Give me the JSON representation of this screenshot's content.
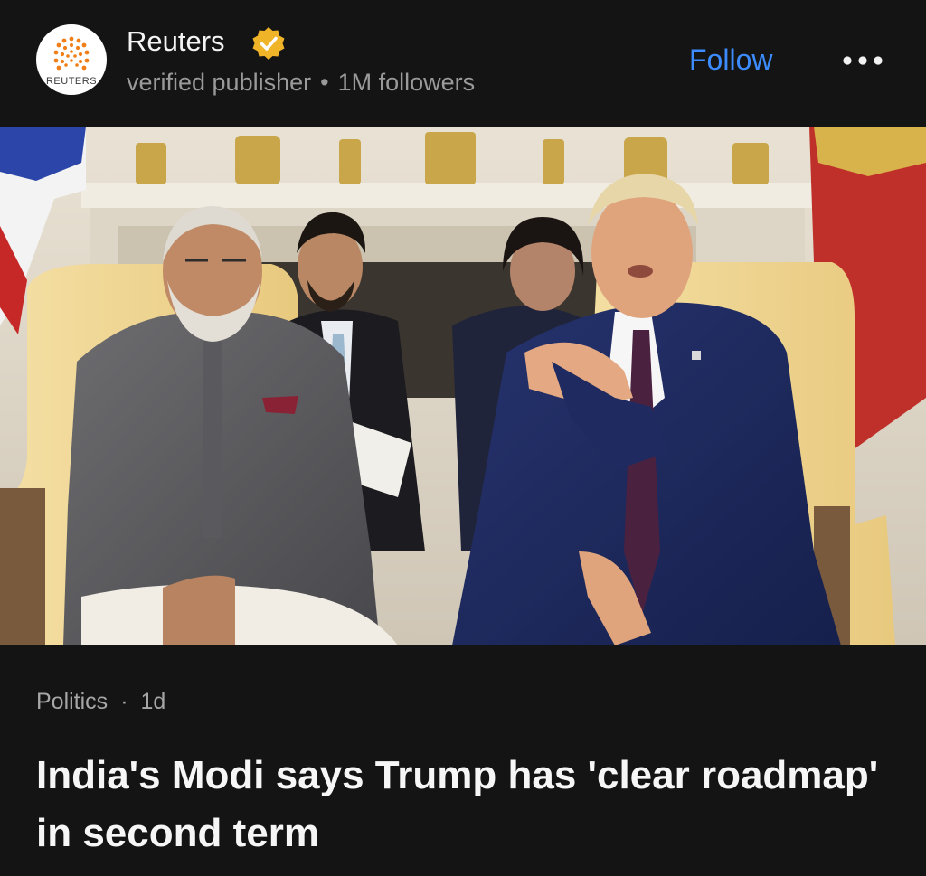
{
  "publisher": {
    "name": "Reuters",
    "logo_text": "REUTERS",
    "subtitle": "verified publisher",
    "followers": "1M followers",
    "separator": "•",
    "verified_icon": "verified-badge-icon",
    "follow_label": "Follow",
    "more_icon": "more-horizontal-icon"
  },
  "article": {
    "category": "Politics",
    "separator": "·",
    "age": "1d",
    "headline": "India's Modi says Trump has 'clear roadmap' in second term",
    "image_alt": "Modi and Trump seated in the Oval Office"
  },
  "colors": {
    "background": "#141414",
    "accent": "#3c8cff",
    "badge": "#f0b429",
    "muted_text": "#9a9a9a",
    "logo_orange": "#f07f1a"
  }
}
